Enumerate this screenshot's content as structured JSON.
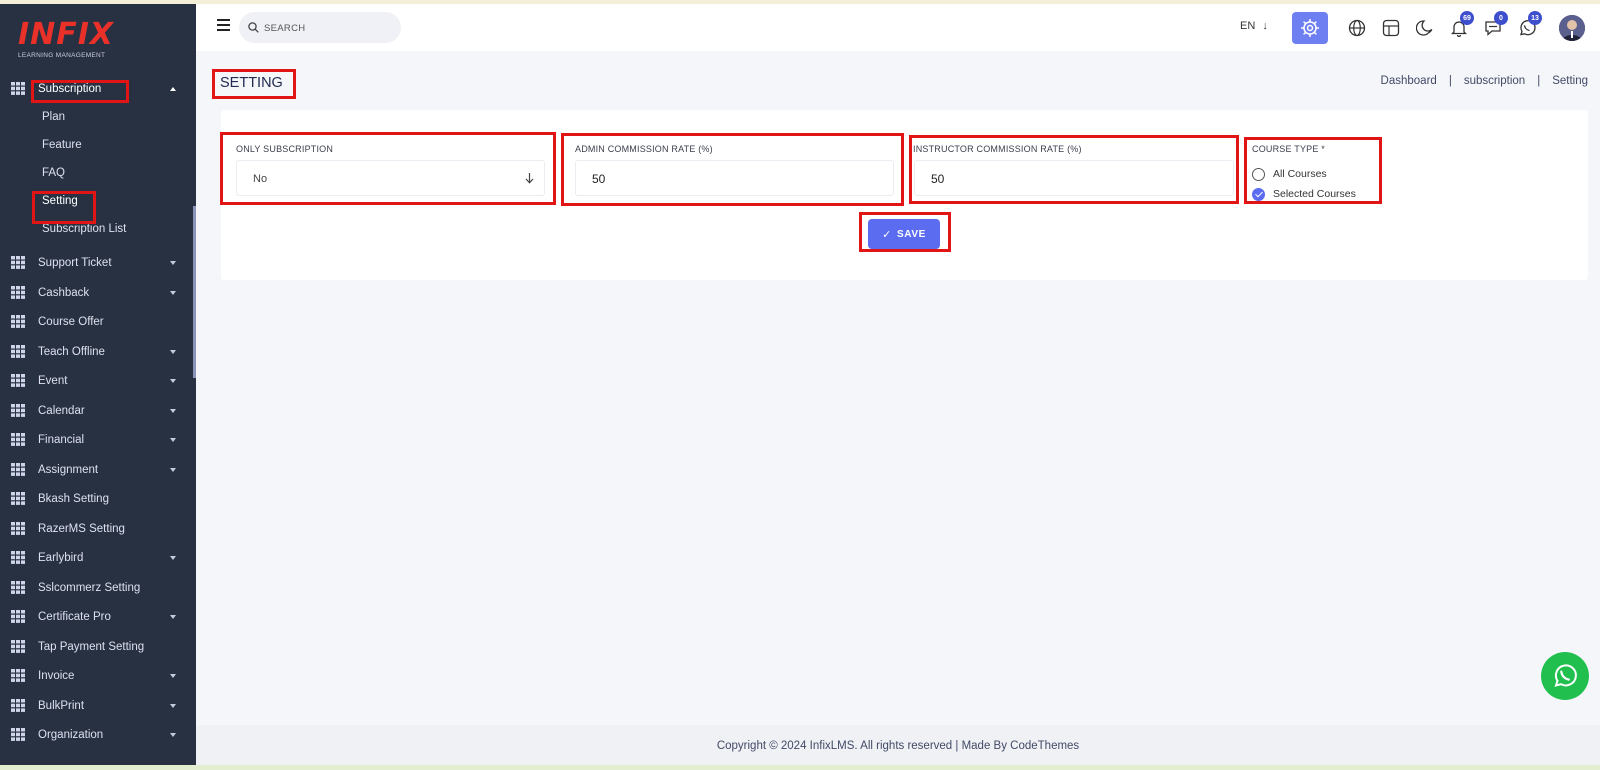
{
  "logo": {
    "brand": "INFIX",
    "tagline": "LEARNING MANAGEMENT"
  },
  "sidebar": {
    "active_menu": {
      "label": "Subscription"
    },
    "sub_items": [
      "Plan",
      "Feature",
      "FAQ",
      "Setting",
      "Subscription List"
    ],
    "items": [
      {
        "label": "Support Ticket",
        "has_caret": true
      },
      {
        "label": "Cashback",
        "has_caret": true
      },
      {
        "label": "Course Offer",
        "has_caret": false
      },
      {
        "label": "Teach Offline",
        "has_caret": true
      },
      {
        "label": "Event",
        "has_caret": true
      },
      {
        "label": "Calendar",
        "has_caret": true
      },
      {
        "label": "Financial",
        "has_caret": true
      },
      {
        "label": "Assignment",
        "has_caret": true
      },
      {
        "label": "Bkash Setting",
        "has_caret": false
      },
      {
        "label": "RazerMS Setting",
        "has_caret": false
      },
      {
        "label": "Earlybird",
        "has_caret": true
      },
      {
        "label": "Sslcommerz Setting",
        "has_caret": false
      },
      {
        "label": "Certificate Pro",
        "has_caret": true
      },
      {
        "label": "Tap Payment Setting",
        "has_caret": false
      },
      {
        "label": "Invoice",
        "has_caret": true
      },
      {
        "label": "BulkPrint",
        "has_caret": true
      },
      {
        "label": "Organization",
        "has_caret": true
      }
    ]
  },
  "header": {
    "search_placeholder": "SEARCH",
    "language": "EN",
    "notifications_count": "69",
    "messages_count": "0",
    "whatsapp_count": "13"
  },
  "page": {
    "title": "SETTING",
    "breadcrumb": [
      "Dashboard",
      "subscription",
      "Setting"
    ]
  },
  "form": {
    "only_subscription_label": "ONLY SUBSCRIPTION",
    "only_subscription_value": "No",
    "admin_rate_label": "ADMIN COMMISSION RATE (%)",
    "admin_rate_value": "50",
    "instructor_rate_label": "INSTRUCTOR COMMISSION RATE (%)",
    "instructor_rate_value": "50",
    "course_type_label": "COURSE TYPE *",
    "course_type_options": [
      "All Courses",
      "Selected Courses"
    ],
    "course_type_selected": "Selected Courses",
    "save_label": "SAVE"
  },
  "footer": {
    "text": "Copyright © 2024 InfixLMS. All rights reserved | Made By CodeThemes"
  },
  "colors": {
    "sidebar_bg": "#283142",
    "accent": "#5b6cf0",
    "highlight_box": "#e11515",
    "whatsapp": "#21c04e"
  }
}
